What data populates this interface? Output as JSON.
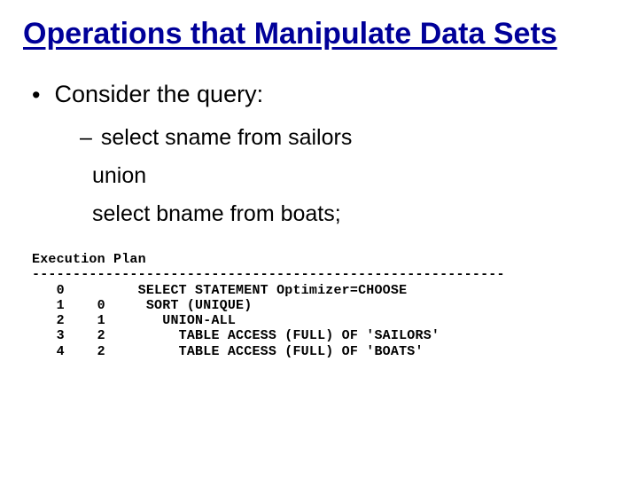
{
  "title": "Operations that Manipulate Data Sets",
  "bullet1": "Consider the query:",
  "sub1": "select sname from sailors",
  "sub2": "union",
  "sub3": "select bname from boats;",
  "plan": {
    "header": "Execution Plan",
    "sep": "----------------------------------------------------------",
    "rows": [
      {
        "id": "0",
        "pid": " ",
        "op": "SELECT STATEMENT Optimizer=CHOOSE"
      },
      {
        "id": "1",
        "pid": "0",
        "op": "  SORT (UNIQUE)"
      },
      {
        "id": "2",
        "pid": "1",
        "op": "    UNION-ALL"
      },
      {
        "id": "3",
        "pid": "2",
        "op": "      TABLE ACCESS (FULL) OF 'SAILORS'"
      },
      {
        "id": "4",
        "pid": "2",
        "op": "      TABLE ACCESS (FULL) OF 'BOATS'"
      }
    ]
  }
}
